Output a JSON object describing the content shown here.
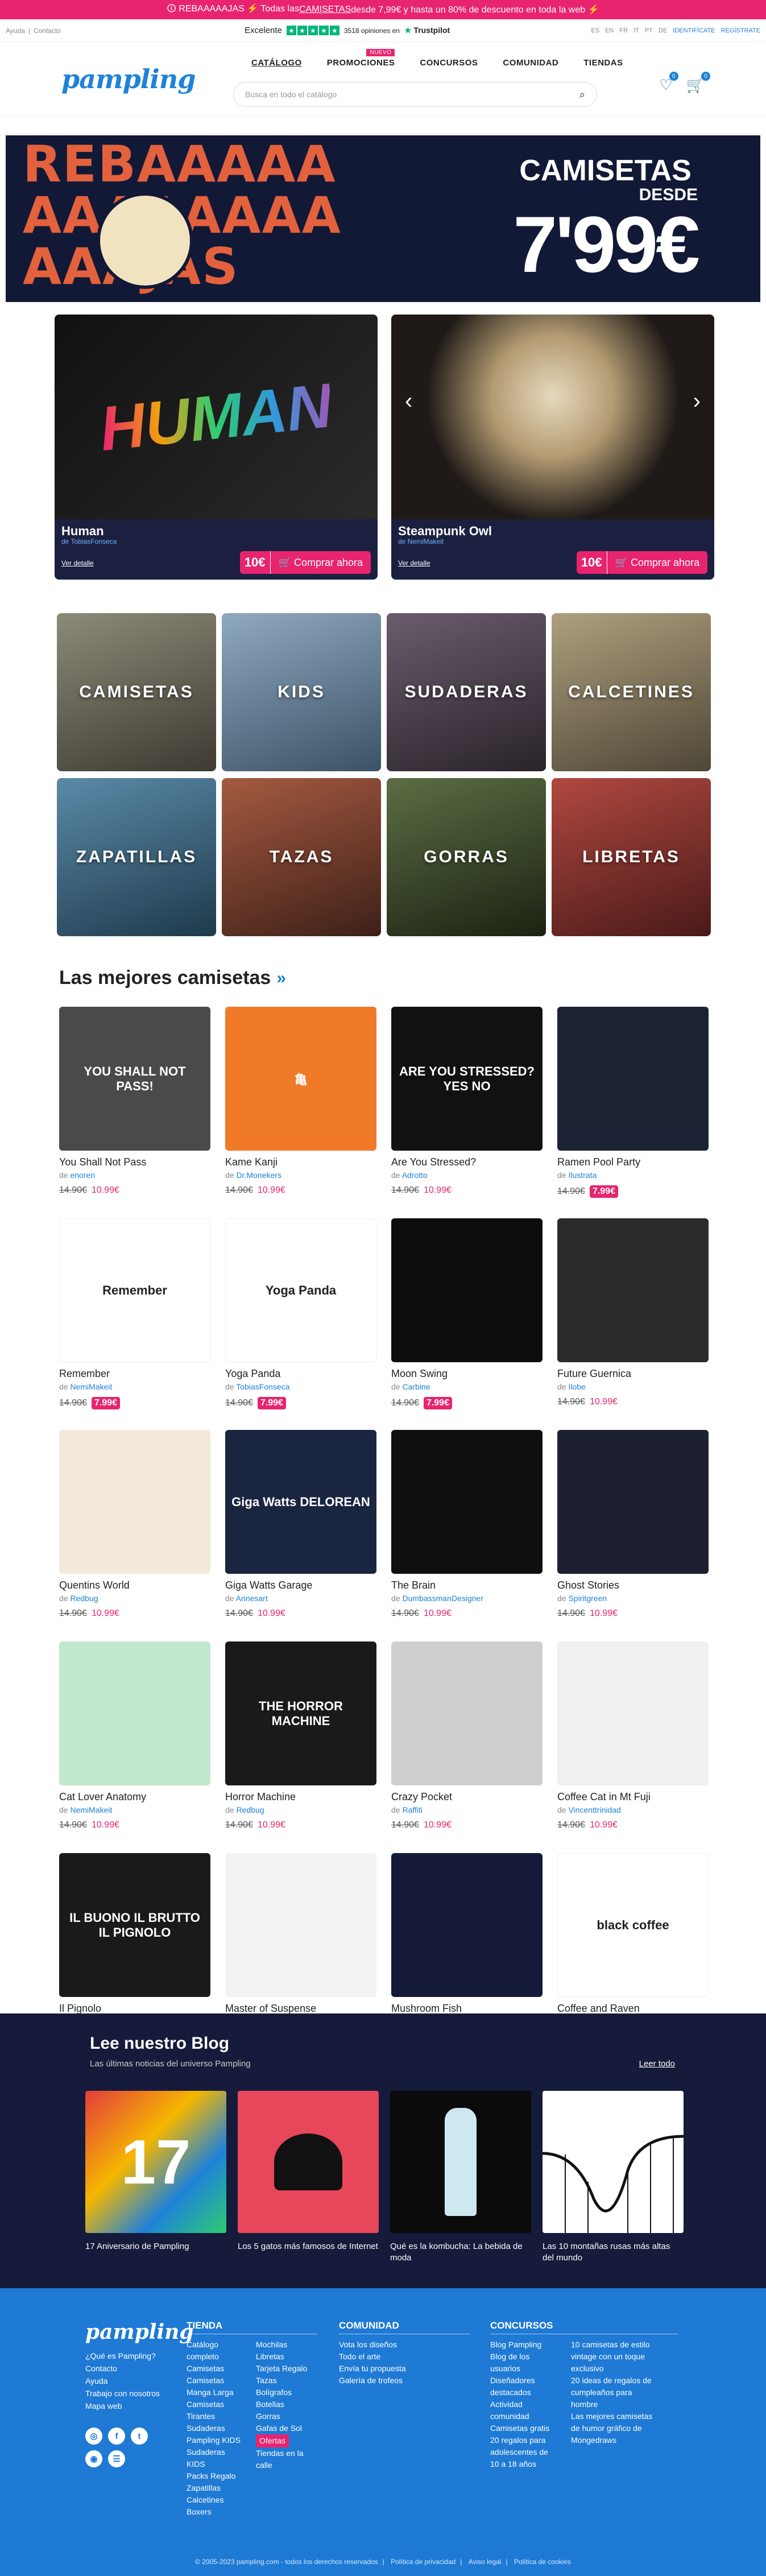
{
  "promo_bar": {
    "text_before": "🛈 REBAAAAAJAS ⚡ Todas las ",
    "link": "CAMISETAS",
    "text_after": " desde 7,99€ y hasta un 80% de descuento en toda la web ⚡"
  },
  "topbar": {
    "help": "Ayuda",
    "sep": "|",
    "contact": "Contacto",
    "rating_label": "Excelente",
    "reviews": "3518 opiniones en",
    "trustpilot": "Trustpilot",
    "languages": [
      "ES",
      "EN",
      "FR",
      "IT",
      "PT",
      "DE"
    ],
    "login": "IDENTIFÍCATE",
    "register": "REGÍSTRATE"
  },
  "header": {
    "logo": "pampling",
    "nav": [
      {
        "label": "CATÁLOGO"
      },
      {
        "label": "PROMOCIONES",
        "tag": "NUEVO"
      },
      {
        "label": "CONCURSOS"
      },
      {
        "label": "COMUNIDAD"
      },
      {
        "label": "TIENDAS"
      }
    ],
    "search_placeholder": "Busca en todo el catálogo",
    "wishlist_count": "0",
    "cart_count": "0"
  },
  "banner": {
    "lines": [
      "REBAAAAA",
      "AAAAAAAA",
      "AAAJAS"
    ],
    "t1": "CAMISETAS",
    "t2": "DESDE",
    "t3": "7'99€"
  },
  "hero": [
    {
      "name": "Human",
      "author": "de TobiasFonseca",
      "details": "Ver detalle",
      "price": "10€",
      "buy": "🛒 Comprar ahora",
      "color1": "#1a1a1a",
      "color2": "#e8246f"
    },
    {
      "name": "Steampunk Owl",
      "author": "de NemiMakeit",
      "details": "Ver detalle",
      "price": "10€",
      "buy": "🛒 Comprar ahora",
      "color1": "#1f1a17",
      "color2": "#d9c7a8"
    }
  ],
  "categories": [
    {
      "label": "CAMISETAS",
      "color": "#6b6a5e"
    },
    {
      "label": "KIDS",
      "color": "#5c7a96"
    },
    {
      "label": "SUDADERAS",
      "color": "#4a3f4a"
    },
    {
      "label": "CALCETINES",
      "color": "#8a7e64"
    },
    {
      "label": "ZAPATILLAS",
      "color": "#355c74"
    },
    {
      "label": "TAZAS",
      "color": "#6e3b2e"
    },
    {
      "label": "GORRAS",
      "color": "#2e3a22"
    },
    {
      "label": "LIBRETAS",
      "color": "#7c2e2a"
    }
  ],
  "best_title": "Las mejores camisetas",
  "products": [
    {
      "name": "You Shall Not Pass",
      "author": "enoren",
      "old": "14.90€",
      "new": "10.99€",
      "hl": false,
      "bg": "#4a4a4a",
      "art": "YOU SHALL NOT PASS!"
    },
    {
      "name": "Kame Kanji",
      "author": "Dr.Monekers",
      "old": "14.90€",
      "new": "10.99€",
      "hl": false,
      "bg": "#f07a28",
      "art": "亀"
    },
    {
      "name": "Are You Stressed?",
      "author": "Adrotto",
      "old": "14.90€",
      "new": "10.99€",
      "hl": false,
      "bg": "#111111",
      "art": "ARE YOU STRESSED? YES NO"
    },
    {
      "name": "Ramen Pool Party",
      "author": "Ilustrata",
      "old": "14.90€",
      "new": "7.99€",
      "hl": true,
      "bg": "#1b2233",
      "art": ""
    },
    {
      "name": "Remember",
      "author": "NemiMakeit",
      "old": "14.90€",
      "new": "7.99€",
      "hl": true,
      "bg": "#ffffff",
      "art": "Remember"
    },
    {
      "name": "Yoga Panda",
      "author": "TobiasFonseca",
      "old": "14.90€",
      "new": "7.99€",
      "hl": true,
      "bg": "#ffffff",
      "art": "Yoga Panda"
    },
    {
      "name": "Moon Swing",
      "author": "Carbine",
      "old": "14.90€",
      "new": "7.99€",
      "hl": true,
      "bg": "#0d0d0d",
      "art": ""
    },
    {
      "name": "Future Guernica",
      "author": "Ilobe",
      "old": "14.90€",
      "new": "10.99€",
      "hl": false,
      "bg": "#2b2b2b",
      "art": ""
    },
    {
      "name": "Quentins World",
      "author": "Redbug",
      "old": "14.90€",
      "new": "10.99€",
      "hl": false,
      "bg": "#f3e9da",
      "art": ""
    },
    {
      "name": "Giga Watts Garage",
      "author": "Arinesart",
      "old": "14.90€",
      "new": "10.99€",
      "hl": false,
      "bg": "#1a2540",
      "art": "Giga Watts DELOREAN"
    },
    {
      "name": "The Brain",
      "author": "DumbassmanDesigner",
      "old": "14.90€",
      "new": "10.99€",
      "hl": false,
      "bg": "#0f0f0f",
      "art": ""
    },
    {
      "name": "Ghost Stories",
      "author": "Spiritgreen",
      "old": "14.90€",
      "new": "10.99€",
      "hl": false,
      "bg": "#1c2030",
      "art": ""
    },
    {
      "name": "Cat Lover Anatomy",
      "author": "NemiMakeit",
      "old": "14.90€",
      "new": "10.99€",
      "hl": false,
      "bg": "#bfe8cf",
      "art": ""
    },
    {
      "name": "Horror Machine",
      "author": "Redbug",
      "old": "14.90€",
      "new": "10.99€",
      "hl": false,
      "bg": "#1a1a1a",
      "art": "THE HORROR MACHINE"
    },
    {
      "name": "Crazy Pocket",
      "author": "Raffiti",
      "old": "14.90€",
      "new": "10.99€",
      "hl": false,
      "bg": "#cfcfcf",
      "art": ""
    },
    {
      "name": "Coffee Cat in Mt Fuji",
      "author": "Vincenttrinidad",
      "old": "14.90€",
      "new": "10.99€",
      "hl": false,
      "bg": "#f0f0f0",
      "art": ""
    },
    {
      "name": "Il Pignolo",
      "author": "",
      "old": "",
      "new": "",
      "hl": false,
      "bg": "#1a1a1a",
      "art": "IL BUONO IL BRUTTO IL PIGNOLO"
    },
    {
      "name": "Master of Suspense",
      "author": "",
      "old": "",
      "new": "",
      "hl": false,
      "bg": "#f2f2f2",
      "art": ""
    },
    {
      "name": "Mushroom Fish",
      "author": "",
      "old": "",
      "new": "",
      "hl": false,
      "bg": "#141a38",
      "art": ""
    },
    {
      "name": "Coffee and Raven",
      "author": "",
      "old": "",
      "new": "",
      "hl": false,
      "bg": "#ffffff",
      "art": "black coffee"
    }
  ],
  "by_prefix": "de ",
  "blog": {
    "title": "Lee nuestro Blog",
    "subtitle": "Las últimas noticias del universo Pampling",
    "more": "Leer todo",
    "posts": [
      {
        "title": "17 Aniversario de Pampling",
        "bg": "#e43c3c"
      },
      {
        "title": "Los 5 gatos más famosos de Internet",
        "bg": "#e8465a"
      },
      {
        "title": "Qué es la kombucha: La bebida de moda",
        "bg": "#0b0b0b"
      },
      {
        "title": "Las 10 montañas rusas más altas del mundo",
        "bg": "#ffffff"
      }
    ]
  },
  "footer": {
    "logo": "pampling",
    "links_left": [
      "¿Qué es Pampling?",
      "Contacto",
      "Ayuda",
      "Trabajo con nosotros",
      "Mapa web"
    ],
    "social": [
      "◎",
      "f",
      "t",
      "◉",
      "☰"
    ],
    "tienda": {
      "title": "TIENDA",
      "col1": [
        "Catálogo completo",
        "Camisetas",
        "Camisetas Manga Larga",
        "Camisetas Tirantes",
        "Sudaderas",
        "Pampling KIDS",
        "Sudaderas KIDS",
        "Packs Regalo",
        "Zapatillas",
        "Calcetines",
        "Boxers"
      ],
      "col2": [
        "Mochilas",
        "Libretas",
        "Tarjeta Regalo",
        "Tazas",
        "Bolígrafos",
        "Botellas",
        "Gorras",
        "Gafas de Sol",
        "Ofertas",
        "Tiendas en la calle"
      ]
    },
    "comunidad": {
      "title": "COMUNIDAD",
      "items": [
        "Vota los diseños",
        "Todo el arte",
        "Envía tu propuesta",
        "Galería de trofeos"
      ]
    },
    "concursos": {
      "title": "CONCURSOS",
      "col1": [
        "Blog Pampling",
        "Blog de los usuarios",
        "Diseñadores destacados",
        "Actividad comunidad",
        "Camisetas gratis",
        "20 regalos para adolescentes de 10 a 18 años"
      ],
      "col2": [
        "10 camisetas de estilo vintage con un toque exclusivo",
        "20 ideas de regalos de cumpleaños para hombre",
        "Las mejores camisetas de humor gráfico de Mongedraws"
      ]
    },
    "bottom": [
      "© 2005-2023 pampling.com - todos los derechos reservados",
      "Política de privacidad",
      "Aviso legal",
      "Política de cookies"
    ]
  }
}
